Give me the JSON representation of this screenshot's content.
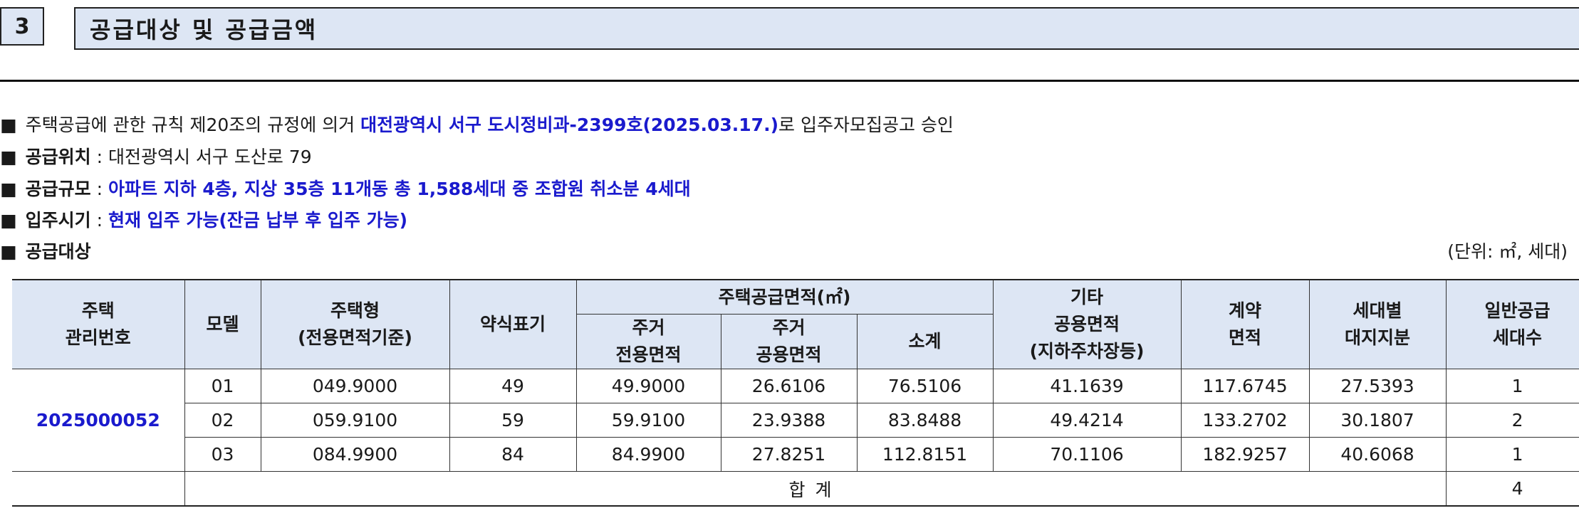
{
  "section": {
    "number": "3",
    "title": "공급대상 및 공급금액"
  },
  "bullet_glyph": "■",
  "lines": {
    "approval": {
      "prefix": "주택공급에 관한 규칙 제20조의 규정에 의거 ",
      "highlight": "대전광역시 서구 도시정비과-2399호(2025.03.17.)",
      "suffix": "로 입주자모집공고 승인"
    },
    "location": {
      "label": "공급위치",
      "sep": " : ",
      "value": "대전광역시 서구 도산로 79"
    },
    "scale": {
      "label": "공급규모",
      "sep": " : ",
      "value": "아파트 지하 4층, 지상 35층 11개동 총 1,588세대 중 조합원 취소분 4세대"
    },
    "move_in": {
      "label": "입주시기",
      "sep": " : ",
      "value": "현재 입주 가능(잔금 납부 후 입주 가능)"
    },
    "target": {
      "label": "공급대상"
    }
  },
  "unit_note": "(단위: ㎡, 세대)",
  "table": {
    "headers": {
      "mgmt_no": [
        "주택",
        "관리번호"
      ],
      "model": "모델",
      "housing_type": [
        "주택형",
        "(전용면적기준)"
      ],
      "short_label": "약식표기",
      "supply_area": "주택공급면적(㎡)",
      "exclusive": [
        "주거",
        "전용면적"
      ],
      "common": [
        "주거",
        "공용면적"
      ],
      "subtotal": "소계",
      "other_common": [
        "기타",
        "공용면적",
        "(지하주차장등)"
      ],
      "contract": [
        "계약",
        "면적"
      ],
      "land_share": [
        "세대별",
        "대지지분"
      ],
      "general_units": [
        "일반공급",
        "세대수"
      ]
    },
    "mgmt_no": "2025000052",
    "rows": [
      [
        "01",
        "049.9000",
        "49",
        "49.9000",
        "26.6106",
        "76.5106",
        "41.1639",
        "117.6745",
        "27.5393",
        "1"
      ],
      [
        "02",
        "059.9100",
        "59",
        "59.9100",
        "23.9388",
        "83.8488",
        "49.4214",
        "133.2702",
        "30.1807",
        "2"
      ],
      [
        "03",
        "084.9900",
        "84",
        "84.9900",
        "27.8251",
        "112.8151",
        "70.1106",
        "182.9257",
        "40.6068",
        "1"
      ]
    ],
    "total_label": "합계",
    "total_value": "4"
  }
}
